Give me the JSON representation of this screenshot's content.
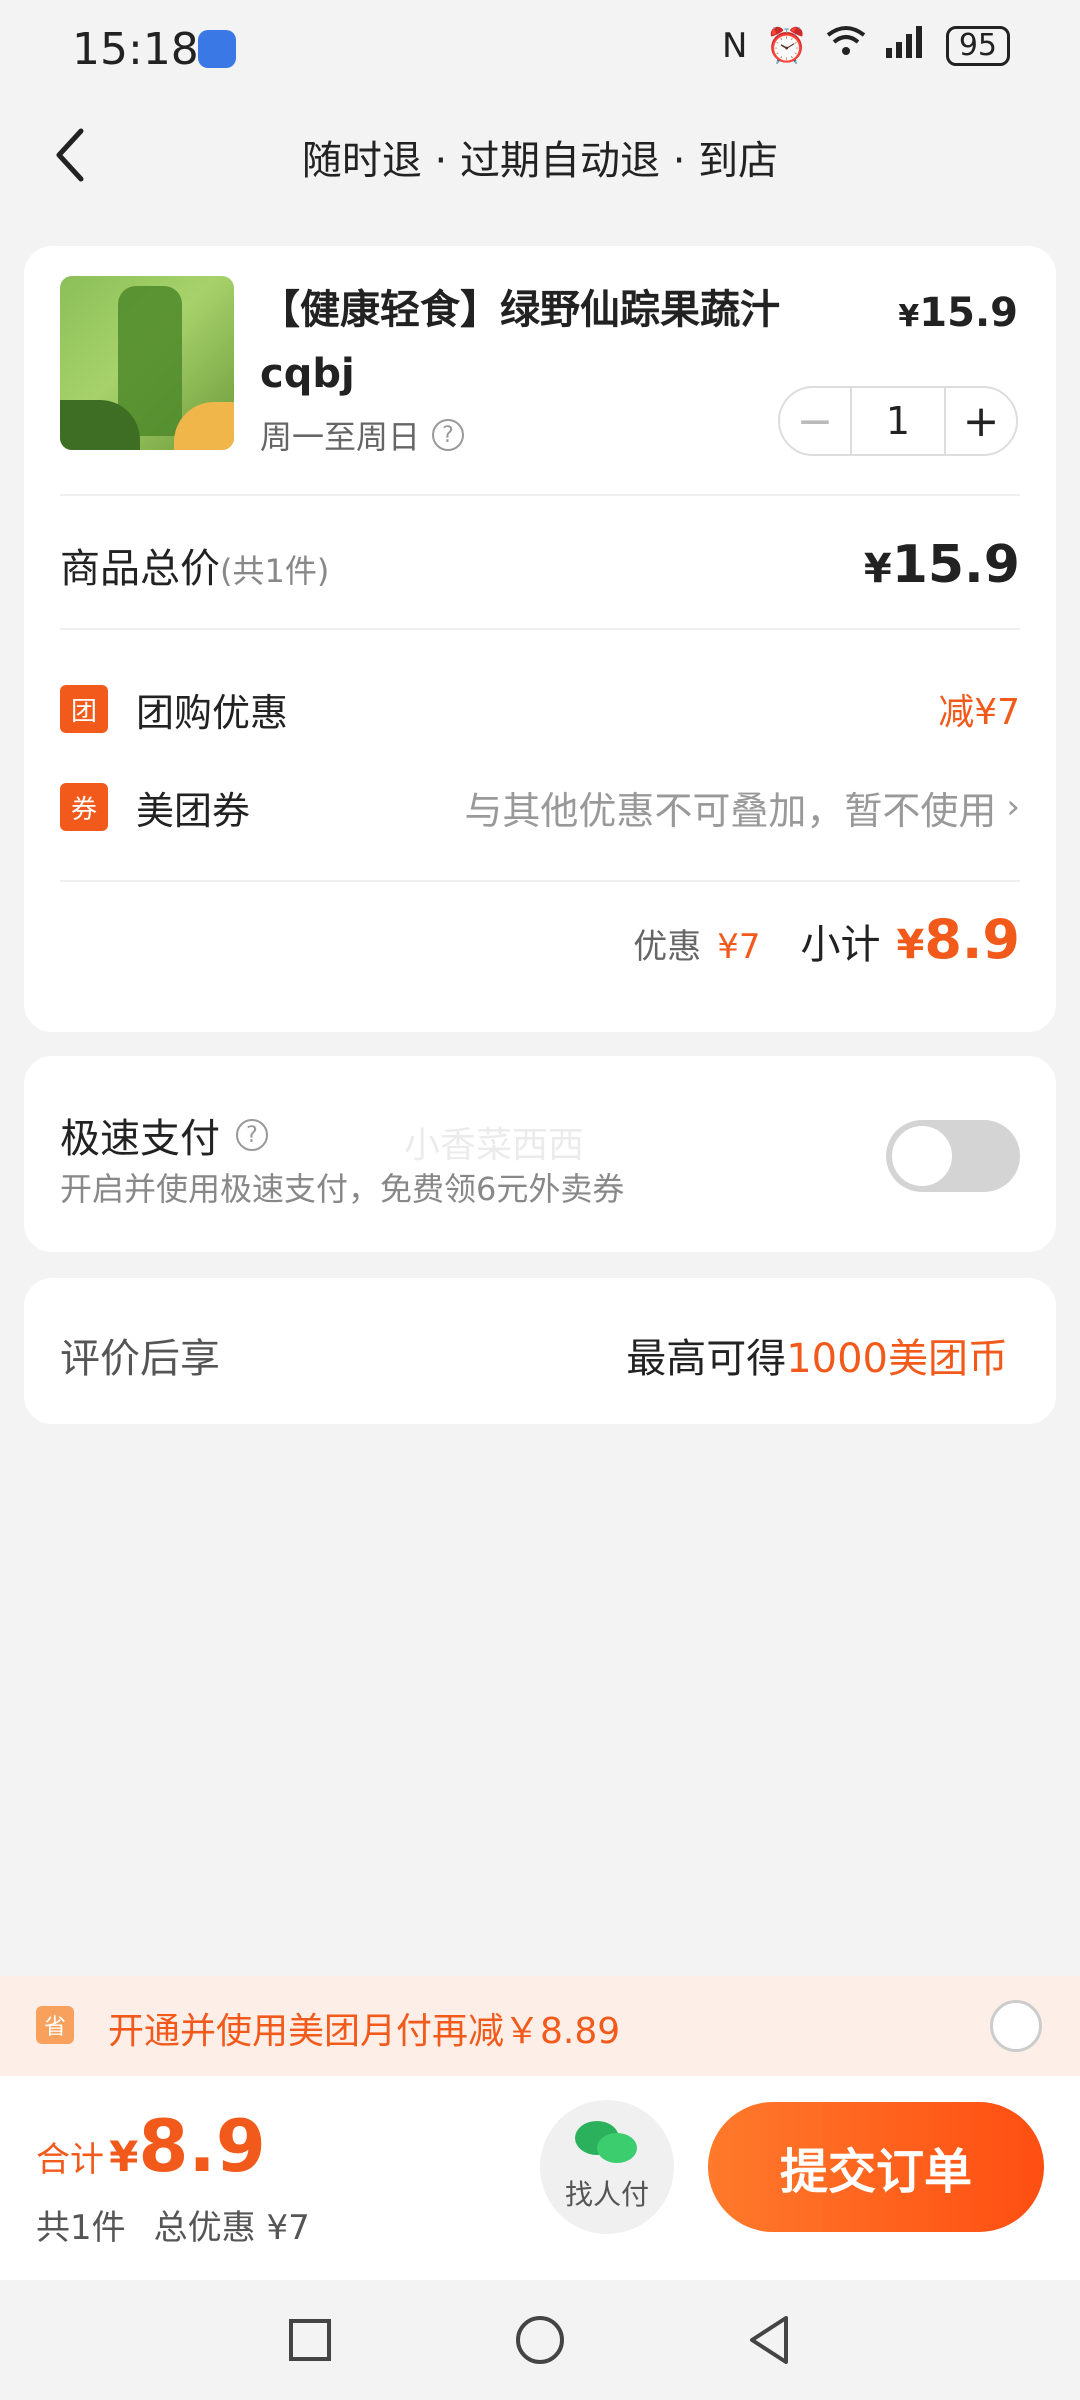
{
  "status": {
    "time": "15:18",
    "battery": "95"
  },
  "header": {
    "title": "随时退 · 过期自动退 · 到店"
  },
  "product": {
    "name": "【健康轻食】绿野仙踪果蔬汁cqbj",
    "days": "周一至周日",
    "price_yen": "¥",
    "price": "15.9",
    "qty": "1"
  },
  "summary": {
    "total_label": "商品总价",
    "total_sub": "(共1件)",
    "total_yen": "¥",
    "total_value": "15.9"
  },
  "promos": {
    "group_badge": "团",
    "group_label": "团购优惠",
    "group_value": "减¥7",
    "coupon_badge": "券",
    "coupon_label": "美团券",
    "coupon_note": "与其他优惠不可叠加，暂不使用"
  },
  "subtotal": {
    "discount_label": "优惠",
    "discount_value": "¥7",
    "label": "小计",
    "yen": "¥",
    "value": "8.9"
  },
  "express_pay": {
    "title": "极速支付",
    "desc": "开启并使用极速支付，免费领6元外卖券",
    "watermark": "小香菜西西",
    "enabled": false
  },
  "review": {
    "label": "评价后享",
    "value_prefix": "最高可得",
    "value_accent": "1000美团币"
  },
  "monthly": {
    "icon_text": "省",
    "text": "开通并使用美团月付再减￥8.89"
  },
  "bottom": {
    "total_label": "合计",
    "total_yen": "¥",
    "total_value": "8.9",
    "count": "共1件",
    "total_discount": "总优惠 ¥7",
    "friend_pay": "找人付",
    "submit": "提交订单"
  },
  "colors": {
    "accent": "#f25a1b",
    "button_start": "#ff7a2b",
    "button_end": "#ff4e12",
    "background": "#f3f3f3"
  }
}
